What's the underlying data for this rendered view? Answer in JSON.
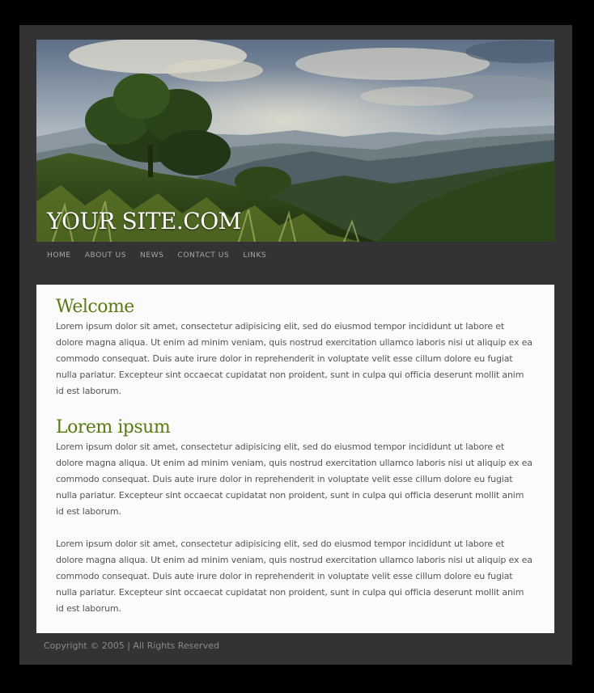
{
  "header": {
    "site_title": "YOUR SITE.COM"
  },
  "nav": {
    "items": [
      {
        "label": "HOME"
      },
      {
        "label": "ABOUT US"
      },
      {
        "label": "NEWS"
      },
      {
        "label": "CONTACT US"
      },
      {
        "label": "LINKS"
      }
    ]
  },
  "content": {
    "sections": [
      {
        "heading": "Welcome",
        "paragraphs": [
          "Lorem ipsum dolor sit amet, consectetur adipisicing elit, sed do eiusmod tempor incididunt ut labore et dolore magna aliqua. Ut enim ad minim veniam, quis nostrud exercitation ullamco laboris nisi ut aliquip ex ea commodo consequat. Duis aute irure dolor in reprehenderit in voluptate velit esse cillum dolore eu fugiat nulla pariatur. Excepteur sint occaecat cupidatat non proident, sunt in culpa qui officia deserunt mollit anim id est laborum."
        ]
      },
      {
        "heading": "Lorem ipsum",
        "paragraphs": [
          "Lorem ipsum dolor sit amet, consectetur adipisicing elit, sed do eiusmod tempor incididunt ut labore et dolore magna aliqua. Ut enim ad minim veniam, quis nostrud exercitation ullamco laboris nisi ut aliquip ex ea commodo consequat. Duis aute irure dolor in reprehenderit in voluptate velit esse cillum dolore eu fugiat nulla pariatur. Excepteur sint occaecat cupidatat non proident, sunt in culpa qui officia deserunt mollit anim id est laborum.",
          "Lorem ipsum dolor sit amet, consectetur adipisicing elit, sed do eiusmod tempor incididunt ut labore et dolore magna aliqua. Ut enim ad minim veniam, quis nostrud exercitation ullamco laboris nisi ut aliquip ex ea commodo consequat. Duis aute irure dolor in reprehenderit in voluptate velit esse cillum dolore eu fugiat nulla pariatur. Excepteur sint occaecat cupidatat non proident, sunt in culpa qui officia deserunt mollit anim id est laborum."
        ]
      }
    ]
  },
  "footer": {
    "copyright": "Copyright © 2005 | All Rights Reserved"
  },
  "colors": {
    "page_background": "#000000",
    "wrapper_background": "#333333",
    "content_background": "#fbfbfb",
    "heading": "#5c7a12",
    "body_text": "#555555",
    "nav_text": "#a8a8a8"
  }
}
